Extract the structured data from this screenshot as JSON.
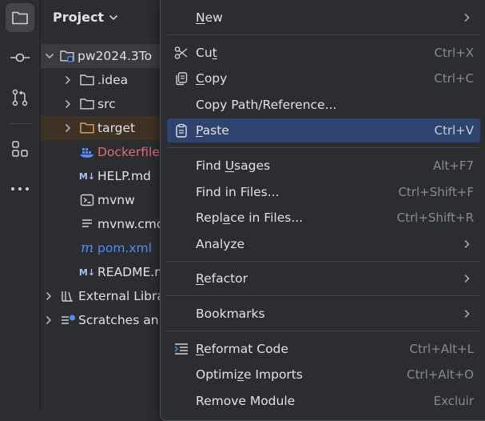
{
  "activity_bar": {
    "items": [
      "project-icon",
      "commit-icon",
      "pull-requests-icon",
      "structure-icon",
      "more-icon"
    ]
  },
  "project_panel": {
    "title": "Project",
    "tree": [
      {
        "label": "pw2024.3To",
        "icon": "module-folder-icon",
        "expanded": true,
        "level": 0
      },
      {
        "label": ".idea",
        "icon": "folder-icon",
        "level": 1
      },
      {
        "label": "src",
        "icon": "folder-icon",
        "level": 1
      },
      {
        "label": "target",
        "icon": "excluded-folder-icon",
        "level": 1
      },
      {
        "label": "Dockerfile",
        "icon": "docker-icon",
        "level": 2,
        "color": "#e06c75"
      },
      {
        "label": "HELP.md",
        "icon": "markdown-icon",
        "level": 2
      },
      {
        "label": "mvnw",
        "icon": "terminal-icon",
        "level": 2
      },
      {
        "label": "mvnw.cmd",
        "icon": "text-file-icon",
        "level": 2
      },
      {
        "label": "pom.xml",
        "icon": "maven-icon",
        "level": 2,
        "color": "#548af7"
      },
      {
        "label": "README.md",
        "icon": "markdown-icon",
        "level": 2
      },
      {
        "label": "External Libra",
        "icon": "library-icon",
        "level": 0
      },
      {
        "label": "Scratches an",
        "icon": "scratches-icon",
        "level": 0
      }
    ]
  },
  "context_menu": {
    "items": [
      {
        "label": "New",
        "mnemonic": "N",
        "submenu": true
      },
      {
        "label": "Cut",
        "mnemonic": "t",
        "shortcut": "Ctrl+X",
        "icon": "scissors-icon"
      },
      {
        "label": "Copy",
        "mnemonic": "C",
        "shortcut": "Ctrl+C",
        "icon": "copy-icon"
      },
      {
        "label": "Copy Path/Reference..."
      },
      {
        "label": "Paste",
        "mnemonic": "P",
        "shortcut": "Ctrl+V",
        "icon": "paste-icon",
        "selected": true
      },
      {
        "label": "Find Usages",
        "mnemonic": "U",
        "shortcut": "Alt+F7"
      },
      {
        "label": "Find in Files...",
        "shortcut": "Ctrl+Shift+F"
      },
      {
        "label": "Replace in Files...",
        "mnemonic": "a",
        "shortcut": "Ctrl+Shift+R"
      },
      {
        "label": "Analyze",
        "submenu": true
      },
      {
        "label": "Refactor",
        "mnemonic": "R",
        "submenu": true
      },
      {
        "label": "Bookmarks",
        "submenu": true
      },
      {
        "label": "Reformat Code",
        "mnemonic": "R",
        "shortcut": "Ctrl+Alt+L",
        "icon": "reformat-icon"
      },
      {
        "label": "Optimize Imports",
        "mnemonic": "z",
        "shortcut": "Ctrl+Alt+O"
      },
      {
        "label": "Remove Module",
        "shortcut": "Excluir"
      }
    ]
  },
  "colors": {
    "background": "#2b2d30",
    "selection": "#2e436e",
    "text": "#dfe1e5",
    "shortcut": "#868a91",
    "excluded_row": "#3d3223",
    "excluded_folder": "#e8a05a",
    "docker_text": "#e06c75",
    "maven_text": "#548af7"
  }
}
